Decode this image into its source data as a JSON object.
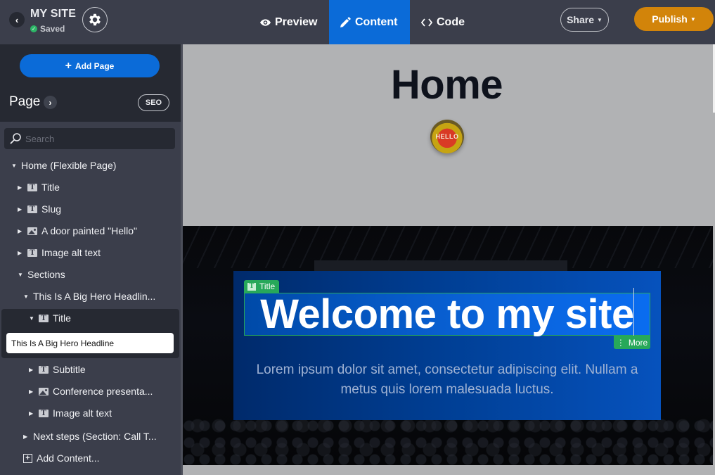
{
  "header": {
    "site_title": "MY SITE",
    "save_status": "Saved",
    "tabs": [
      {
        "label": "Preview",
        "icon": "eye-icon",
        "active": false
      },
      {
        "label": "Content",
        "icon": "pencil-icon",
        "active": true
      },
      {
        "label": "Code",
        "icon": "code-icon",
        "active": false
      }
    ],
    "share_label": "Share",
    "publish_label": "Publish",
    "colors": {
      "active_tab": "#0b6bd8",
      "publish": "#d2840a",
      "saved": "#2db667"
    }
  },
  "sidebar": {
    "add_page_label": "Add Page",
    "page_label": "Page",
    "seo_label": "SEO",
    "search_placeholder": "Search",
    "tree": {
      "root": "Home (Flexible Page)",
      "items": [
        {
          "label": "Title",
          "type": "text"
        },
        {
          "label": "Slug",
          "type": "text"
        },
        {
          "label": "A door painted \"Hello\"",
          "type": "image"
        },
        {
          "label": "Image alt text",
          "type": "text"
        }
      ],
      "sections_label": "Sections",
      "hero_section": "This Is A Big Hero Headlin...",
      "title_node": "Title",
      "title_value": "This Is A Big Hero Headline",
      "hero_children": [
        {
          "label": "Subtitle",
          "type": "text"
        },
        {
          "label": "Conference presenta...",
          "type": "image"
        },
        {
          "label": "Image alt text",
          "type": "text"
        }
      ],
      "next_section": "Next steps (Section: Call T...",
      "add_content": "Add Content..."
    }
  },
  "preview": {
    "page_title": "Home",
    "avatar_text": "HELLO",
    "hero": {
      "title_tag": "Title",
      "title": "Welcome to my site",
      "more_label": "More",
      "subtitle": "Lorem ipsum dolor sit amet, consectetur adipiscing elit. Nullam a metus quis lorem malesuada luctus."
    }
  }
}
